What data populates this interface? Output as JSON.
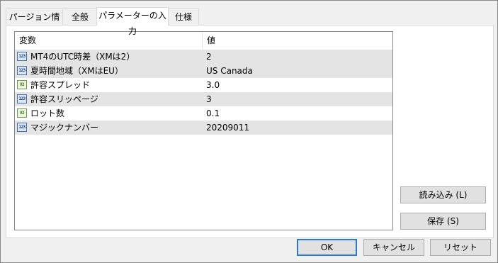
{
  "tabs": [
    {
      "label": "パージョン情報"
    },
    {
      "label": "全般"
    },
    {
      "label": "パラメーターの入力"
    },
    {
      "label": "仕様"
    }
  ],
  "active_tab": "パラメーターの入力",
  "table": {
    "columns": {
      "name": "変数",
      "value": "値"
    },
    "rows": [
      {
        "icon": "int-icon",
        "badge": "123",
        "name": "MT4のUTC時差（XMは2）",
        "value": "2"
      },
      {
        "icon": "int-icon",
        "badge": "123",
        "name": "夏時間地域（XMはEU）",
        "value": "US Canada"
      },
      {
        "icon": "double-icon",
        "badge": "V2",
        "name": "許容スプレッド",
        "value": "3.0"
      },
      {
        "icon": "int-icon",
        "badge": "123",
        "name": "許容スリッページ",
        "value": "3"
      },
      {
        "icon": "double-icon",
        "badge": "V2",
        "name": "ロット数",
        "value": "0.1"
      },
      {
        "icon": "int-icon",
        "badge": "123",
        "name": "マジックナンバー",
        "value": "20209011"
      }
    ]
  },
  "side_buttons": {
    "load": "読み込み (L)",
    "save": "保存 (S)"
  },
  "footer_buttons": {
    "ok": "OK",
    "cancel": "キャンセル",
    "reset": "リセット"
  }
}
